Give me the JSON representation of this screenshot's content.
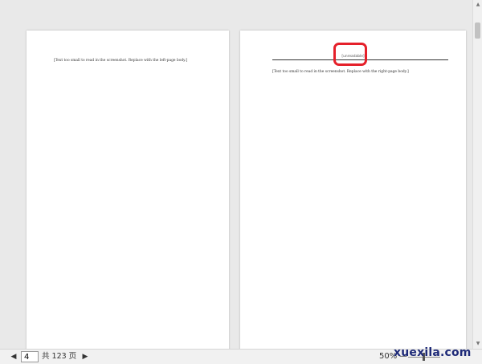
{
  "document": {
    "left_page": {
      "body": "[Text too small to read in the screenshot. Replace with the left-page body.]"
    },
    "right_page": {
      "header": "[unreadable]",
      "body": "[Text too small to read in the screenshot. Replace with the right-page body.]"
    }
  },
  "highlight": {
    "color": "#e5202a"
  },
  "status_bar": {
    "prev_icon": "triangle-left",
    "next_icon": "triangle-right",
    "page_input_value": "4",
    "page_count": "共 123 页",
    "zoom_label": "50%",
    "zoom_minus_label": "—"
  },
  "scrollbar": {
    "up_icon": "triangle-up",
    "down_icon": "triangle-down"
  },
  "watermark": "xuexila.com"
}
